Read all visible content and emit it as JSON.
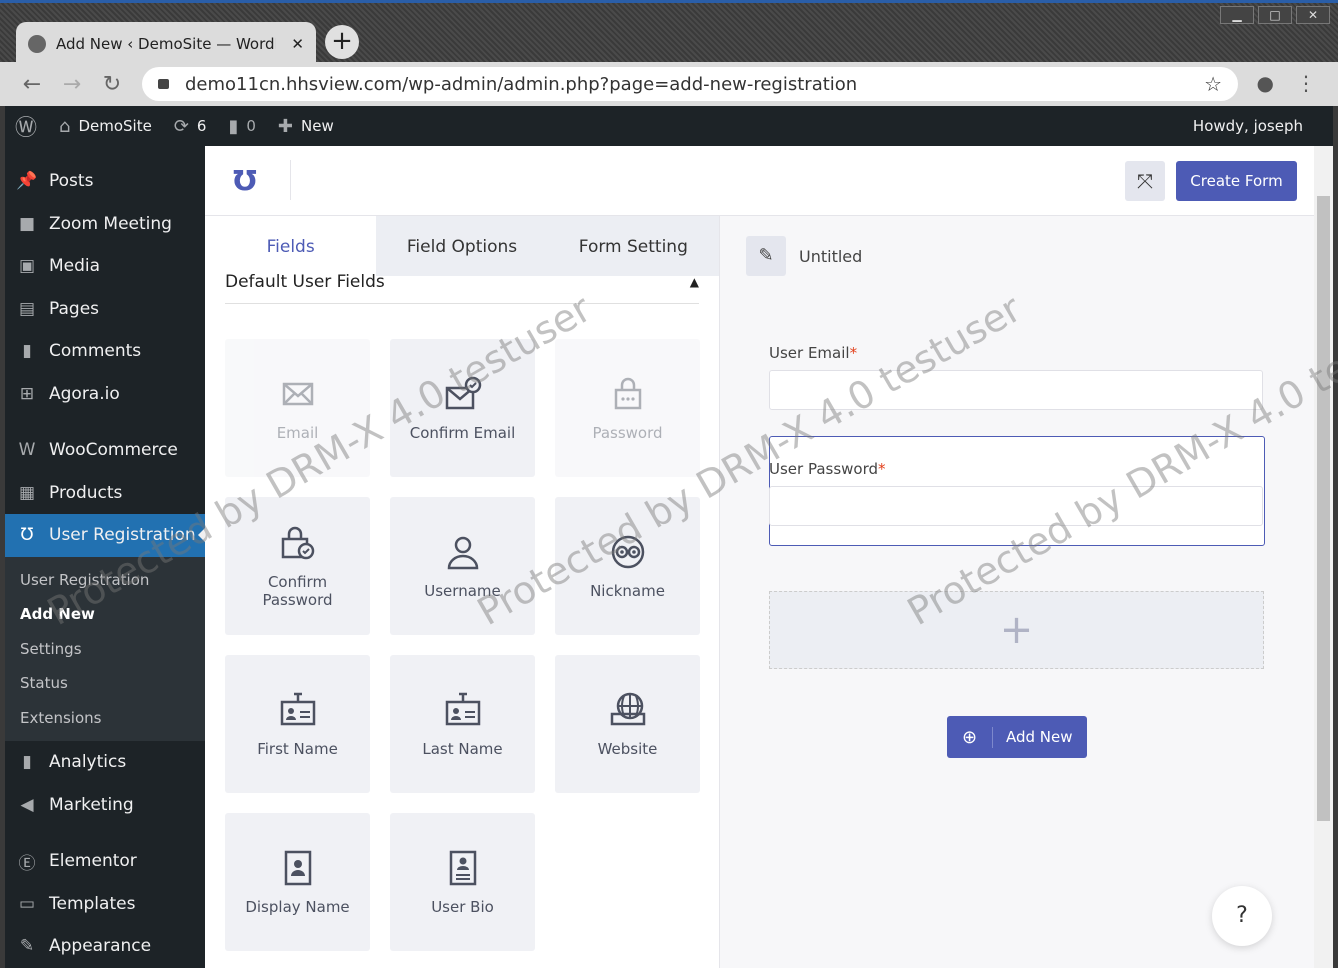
{
  "browser": {
    "tab_title": "Add New ‹ DemoSite — WordPress",
    "url": "demo11cn.hhsview.com/wp-admin/admin.php?page=add-new-registration"
  },
  "adminbar": {
    "site": "DemoSite",
    "updates": "6",
    "comments": "0",
    "new": "New",
    "howdy": "Howdy, joseph"
  },
  "sidebar": {
    "items": [
      {
        "label": "Posts",
        "icon": "pin"
      },
      {
        "label": "Zoom Meeting",
        "icon": "video"
      },
      {
        "label": "Media",
        "icon": "media"
      },
      {
        "label": "Pages",
        "icon": "page"
      },
      {
        "label": "Comments",
        "icon": "comment"
      },
      {
        "label": "Agora.io",
        "icon": "plus-box"
      },
      {
        "label": "WooCommerce",
        "icon": "woo"
      },
      {
        "label": "Products",
        "icon": "box"
      },
      {
        "label": "User Registration",
        "icon": "ur-logo"
      }
    ],
    "submenu": [
      "User Registration",
      "Add New",
      "Settings",
      "Status",
      "Extensions"
    ],
    "items2": [
      {
        "label": "Analytics",
        "icon": "bars"
      },
      {
        "label": "Marketing",
        "icon": "megaphone"
      },
      {
        "label": "Elementor",
        "icon": "elementor"
      },
      {
        "label": "Templates",
        "icon": "folder"
      },
      {
        "label": "Appearance",
        "icon": "brush"
      }
    ]
  },
  "header": {
    "create_form": "Create Form"
  },
  "tabs": [
    "Fields",
    "Field Options",
    "Form Setting"
  ],
  "section": "Default User Fields",
  "fields": [
    {
      "label": "Email",
      "icon": "envelope",
      "disabled": true
    },
    {
      "label": "Confirm Email",
      "icon": "envelope-check",
      "disabled": false
    },
    {
      "label": "Password",
      "icon": "lock",
      "disabled": true
    },
    {
      "label": "Confirm Password",
      "icon": "lock-check",
      "disabled": false
    },
    {
      "label": "Username",
      "icon": "user",
      "disabled": false
    },
    {
      "label": "Nickname",
      "icon": "glasses",
      "disabled": false
    },
    {
      "label": "First Name",
      "icon": "id-card",
      "disabled": false
    },
    {
      "label": "Last Name",
      "icon": "id-card",
      "disabled": false
    },
    {
      "label": "Website",
      "icon": "globe",
      "disabled": false
    },
    {
      "label": "Display Name",
      "icon": "badge",
      "disabled": false
    },
    {
      "label": "User Bio",
      "icon": "badge-lines",
      "disabled": false
    }
  ],
  "form": {
    "title": "Untitled",
    "email_label": "User Email",
    "password_label": "User Password",
    "required": "*",
    "add_new": "Add New",
    "help": "?"
  },
  "watermark": "Protected by DRM-X 4.0 testuser",
  "colors": {
    "accent": "#4d5bb5",
    "wp_dark": "#1d2327",
    "wp_active": "#2271b1"
  }
}
